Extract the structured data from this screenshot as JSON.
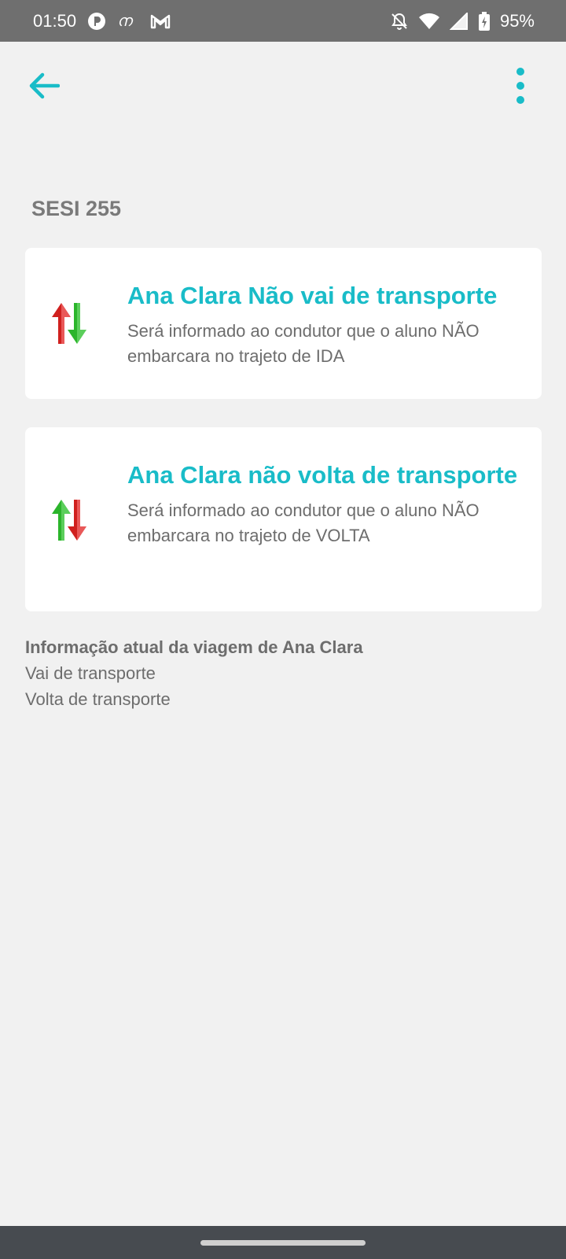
{
  "status_bar": {
    "time": "01:50",
    "battery": "95%"
  },
  "colors": {
    "accent": "#19bcc8",
    "arrow_red": "#d0201e",
    "arrow_green": "#2bb52b"
  },
  "header": {
    "back_icon": "arrow-left-icon",
    "menu_icon": "more-vertical-icon"
  },
  "section": {
    "title": "SESI 255"
  },
  "cards": [
    {
      "title": "Ana Clara Não vai de transporte",
      "description": "Será informado ao condutor que o aluno NÃO embarcara no trajeto de IDA",
      "icon": "swap-arrows-icon"
    },
    {
      "title": "Ana Clara não volta de transporte",
      "description": "Será informado ao condutor que o aluno NÃO embarcara no trajeto de VOLTA",
      "icon": "swap-arrows-icon"
    }
  ],
  "trip_info": {
    "title": "Informação atual da viagem de Ana Clara",
    "line1": "Vai de transporte",
    "line2": "Volta de transporte"
  }
}
